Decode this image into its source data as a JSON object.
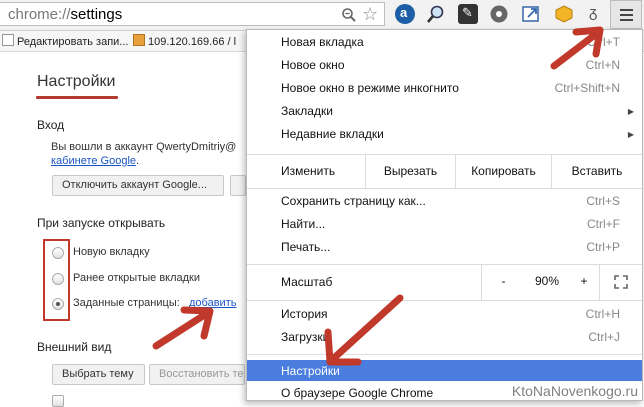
{
  "toolbar": {
    "url_scheme": "chrome://",
    "url_path": "settings",
    "extensions": [
      "a-circle-icon",
      "search-icon",
      "puzzle-icon",
      "drive-icon",
      "export-icon",
      "box-icon",
      "pen-icon"
    ]
  },
  "bookmarks": [
    {
      "label": "Редактировать запи..."
    },
    {
      "label": "109.120.169.66 / l"
    }
  ],
  "settings": {
    "title": "Настройки",
    "signin_heading": "Вход",
    "signin_text": "Вы вошли в аккаунт QwertyDmitriy@",
    "signin_link": "кабинете Google",
    "signin_link_suffix": ".",
    "disconnect_button": "Отключить аккаунт Google...",
    "startup_heading": "При запуске открывать",
    "startup_options": [
      "Новую вкладку",
      "Ранее открытые вкладки",
      "Заданные страницы:"
    ],
    "startup_add_link": "добавить",
    "appearance_heading": "Внешний вид",
    "theme_button": "Выбрать тему",
    "restore_button": "Восстановить те"
  },
  "menu": {
    "items_top": [
      {
        "label": "Новая вкладка",
        "shortcut": "Ctrl+T"
      },
      {
        "label": "Новое окно",
        "shortcut": "Ctrl+N"
      },
      {
        "label": "Новое окно в режиме инкогнито",
        "shortcut": "Ctrl+Shift+N"
      },
      {
        "label": "Закладки",
        "shortcut": ""
      },
      {
        "label": "Недавние вкладки",
        "shortcut": ""
      }
    ],
    "edit_row": {
      "label": "Изменить",
      "cut": "Вырезать",
      "copy": "Копировать",
      "paste": "Вставить"
    },
    "items_mid": [
      {
        "label": "Сохранить страницу как...",
        "shortcut": "Ctrl+S"
      },
      {
        "label": "Найти...",
        "shortcut": "Ctrl+F"
      },
      {
        "label": "Печать...",
        "shortcut": "Ctrl+P"
      }
    ],
    "zoom_row": {
      "label": "Масштаб",
      "minus": "-",
      "value": "90%",
      "plus": "+"
    },
    "items_bottom": [
      {
        "label": "История",
        "shortcut": "Ctrl+H"
      },
      {
        "label": "Загрузки",
        "shortcut": "Ctrl+J"
      },
      {
        "label": "Настройки",
        "shortcut": ""
      },
      {
        "label": "О браузере Google Chrome",
        "shortcut": ""
      }
    ]
  },
  "watermark": "KtoNaNovenkogo.ru",
  "colors": {
    "highlight": "#4a7dde",
    "annotation": "#c0392b",
    "link": "#1a55c4"
  }
}
